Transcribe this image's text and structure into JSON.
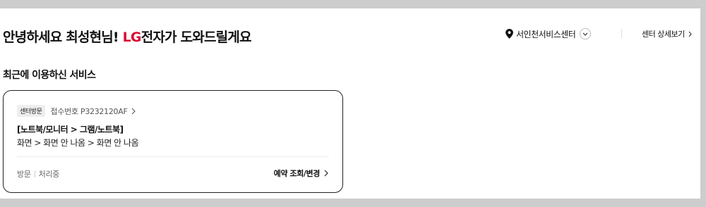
{
  "header": {
    "greeting_prefix": "안녕하세요 최성현님! ",
    "brand": "LG",
    "greeting_suffix": "전자가 도와드릴게요",
    "brand_color": "#d60f33",
    "center_name": "서인천서비스센터",
    "center_detail_label": "센터 상세보기"
  },
  "recent": {
    "title": "최근에 이용하신 서비스",
    "card": {
      "tag": "센터방문",
      "receipt": "접수번호 P3232120AF",
      "product": "[노트북/모니터 > 그램/노트북]",
      "symptom": "화면 > 화면 안 나옴 > 화면 안 나옴",
      "visit_type": "방문",
      "status": "처리중",
      "action_label": "예약 조회/변경"
    }
  },
  "icons": [
    "location-pin-icon",
    "chevron-down-icon",
    "chevron-right-icon"
  ]
}
